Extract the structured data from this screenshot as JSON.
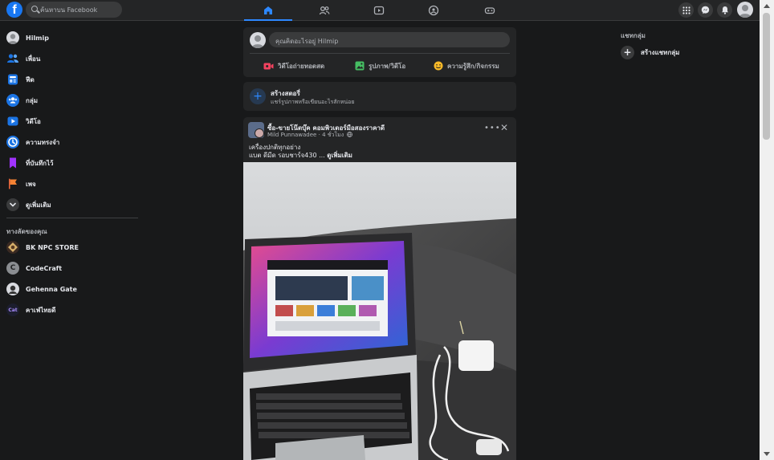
{
  "header": {
    "search_placeholder": "ค้นหาบน Facebook"
  },
  "nav_tabs": [
    {
      "icon": "home-icon",
      "active": true
    },
    {
      "icon": "friends-icon",
      "active": false
    },
    {
      "icon": "watch-icon",
      "active": false
    },
    {
      "icon": "groups-icon",
      "active": false
    },
    {
      "icon": "gaming-icon",
      "active": false
    }
  ],
  "sidebar": {
    "items": [
      {
        "label": "Hilmip",
        "icon": "profile-avatar"
      },
      {
        "label": "เพื่อน",
        "icon": "friends-icon"
      },
      {
        "label": "ฟีด",
        "icon": "feed-icon"
      },
      {
        "label": "กลุ่ม",
        "icon": "groups-icon"
      },
      {
        "label": "วิดีโอ",
        "icon": "video-icon"
      },
      {
        "label": "ความทรงจำ",
        "icon": "memories-icon"
      },
      {
        "label": "ที่บันทึกไว้",
        "icon": "saved-icon"
      },
      {
        "label": "เพจ",
        "icon": "pages-icon"
      },
      {
        "label": "ดูเพิ่มเติม",
        "icon": "chevron-down-icon"
      }
    ],
    "shortcuts_title": "ทางลัดของคุณ",
    "shortcuts": [
      {
        "label": "BK NPC STORE"
      },
      {
        "label": "CodeCraft"
      },
      {
        "label": "Gehenna Gate"
      },
      {
        "label": "คาเฟ่ไทยดี"
      }
    ]
  },
  "composer": {
    "placeholder": "คุณคิดอะไรอยู่ Hilmip",
    "live_label": "วิดีโอถ่ายทอดสด",
    "photo_label": "รูปภาพ/วิดีโอ",
    "feeling_label": "ความรู้สึก/กิจกรรม",
    "colors": {
      "live": "#f3425f",
      "photo": "#45bd62",
      "feeling": "#f7b928"
    }
  },
  "story": {
    "title": "สร้างสตอรี่",
    "subtitle": "แชร์รูปภาพหรือเขียนอะไรสักหน่อย"
  },
  "post": {
    "group_name": "ซื้อ-ขายโน๊ตบุ๊ค คอมพิวเตอร์มือสองราคาดี",
    "author": "Mild Punnawadee",
    "time": "4 ชั่วโมง",
    "line1": "เครื่องปกติทุกอย่าง",
    "line2": "แบต ดีมีด รอบชาร์จ430 ...",
    "see_more": "ดูเพิ่มเติม"
  },
  "right_panel": {
    "title": "แชทกลุ่ม",
    "create_label": "สร้างแชทกลุ่ม"
  }
}
